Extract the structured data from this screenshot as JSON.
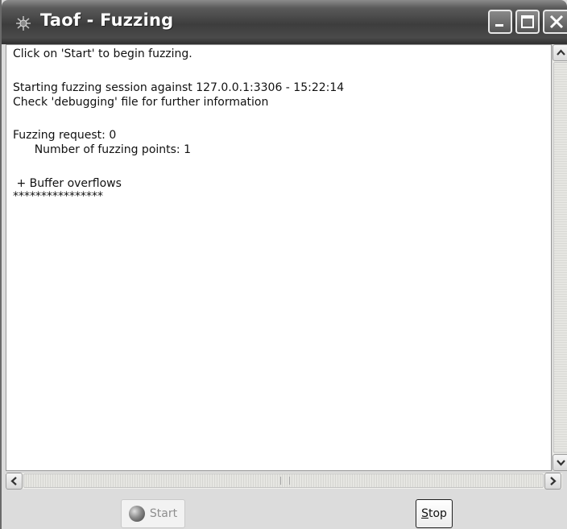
{
  "window": {
    "title": "Taof - Fuzzing"
  },
  "log": {
    "lines": [
      "Click on 'Start' to begin fuzzing.",
      "Starting fuzzing session against 127.0.0.1:3306 - 15:22:14",
      "Check 'debugging' file for further information",
      "Fuzzing request: 0",
      "      Number of fuzzing points: 1",
      " + Buffer overflows",
      "****************"
    ]
  },
  "buttons": {
    "start_label": "Start",
    "stop_prefix": "S",
    "stop_rest": "top"
  },
  "icons": {
    "app": "app-icon",
    "minimize": "minimize-icon",
    "maximize": "maximize-icon",
    "close": "close-icon",
    "start": "start-orb-icon"
  },
  "colors": {
    "titlebar": "#3d3d3d",
    "title_text": "#ffffff",
    "log_background": "#ffffff"
  }
}
